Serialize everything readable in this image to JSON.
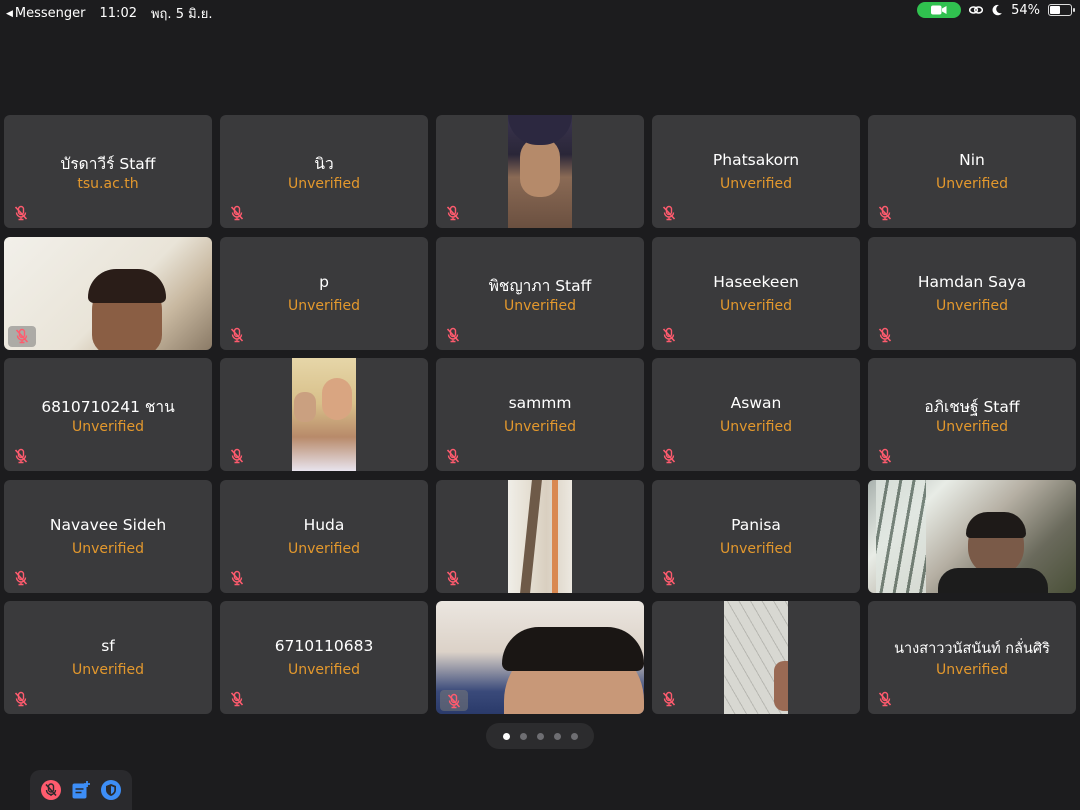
{
  "status_bar": {
    "back_app": "Messenger",
    "time": "11:02",
    "date": "พฤ. 5 มิ.ย.",
    "battery_percent": "54%",
    "battery_level": 0.54,
    "icons": [
      "camera-icon",
      "link-icon",
      "moon-icon",
      "battery-icon"
    ],
    "camera_pill_color": "#30c14f"
  },
  "participants": [
    {
      "name": "บัรดาวีร์ Staff",
      "subtitle": "tsu.ac.th",
      "video": false
    },
    {
      "name": "นิว",
      "subtitle": "Unverified",
      "video": false
    },
    {
      "name": "",
      "subtitle": "",
      "video": true
    },
    {
      "name": "Phatsakorn",
      "subtitle": "Unverified",
      "video": false
    },
    {
      "name": "Nin",
      "subtitle": "Unverified",
      "video": false
    },
    {
      "name": "",
      "subtitle": "",
      "video": true
    },
    {
      "name": "p",
      "subtitle": "Unverified",
      "video": false
    },
    {
      "name": "พิชญาภา Staff",
      "subtitle": "Unverified",
      "video": false
    },
    {
      "name": "Haseekeen",
      "subtitle": "Unverified",
      "video": false
    },
    {
      "name": "Hamdan Saya",
      "subtitle": "Unverified",
      "video": false
    },
    {
      "name": "6810710241 ชาน",
      "subtitle": "Unverified",
      "video": false
    },
    {
      "name": "",
      "subtitle": "",
      "video": true
    },
    {
      "name": "sammm",
      "subtitle": "Unverified",
      "video": false
    },
    {
      "name": "Aswan",
      "subtitle": "Unverified",
      "video": false
    },
    {
      "name": "อภิเชษฐ์ Staff",
      "subtitle": "Unverified",
      "video": false
    },
    {
      "name": "Navavee Sideh",
      "subtitle": "Unverified",
      "video": false
    },
    {
      "name": "Huda",
      "subtitle": "Unverified",
      "video": false
    },
    {
      "name": "",
      "subtitle": "",
      "video": true
    },
    {
      "name": "Panisa",
      "subtitle": "Unverified",
      "video": false
    },
    {
      "name": "",
      "subtitle": "",
      "video": true
    },
    {
      "name": "sf",
      "subtitle": "Unverified",
      "video": false
    },
    {
      "name": "6710110683",
      "subtitle": "Unverified",
      "video": false
    },
    {
      "name": "",
      "subtitle": "",
      "video": true
    },
    {
      "name": "",
      "subtitle": "",
      "video": true
    },
    {
      "name": "นางสาววนัสนันท์ กลั่นศิริ",
      "subtitle": "Unverified",
      "video": false
    }
  ],
  "pagination": {
    "pages": 5,
    "current": 1
  },
  "toolbar": {
    "icons": [
      "mic-muted-icon",
      "add-notes-icon",
      "shield-icon"
    ]
  },
  "colors": {
    "background": "#1c1c1e",
    "tile": "#3a3a3c",
    "unverified": "#e3982d",
    "muted_mic": "#ff5b6e",
    "accent_blue": "#3d8ef7"
  }
}
